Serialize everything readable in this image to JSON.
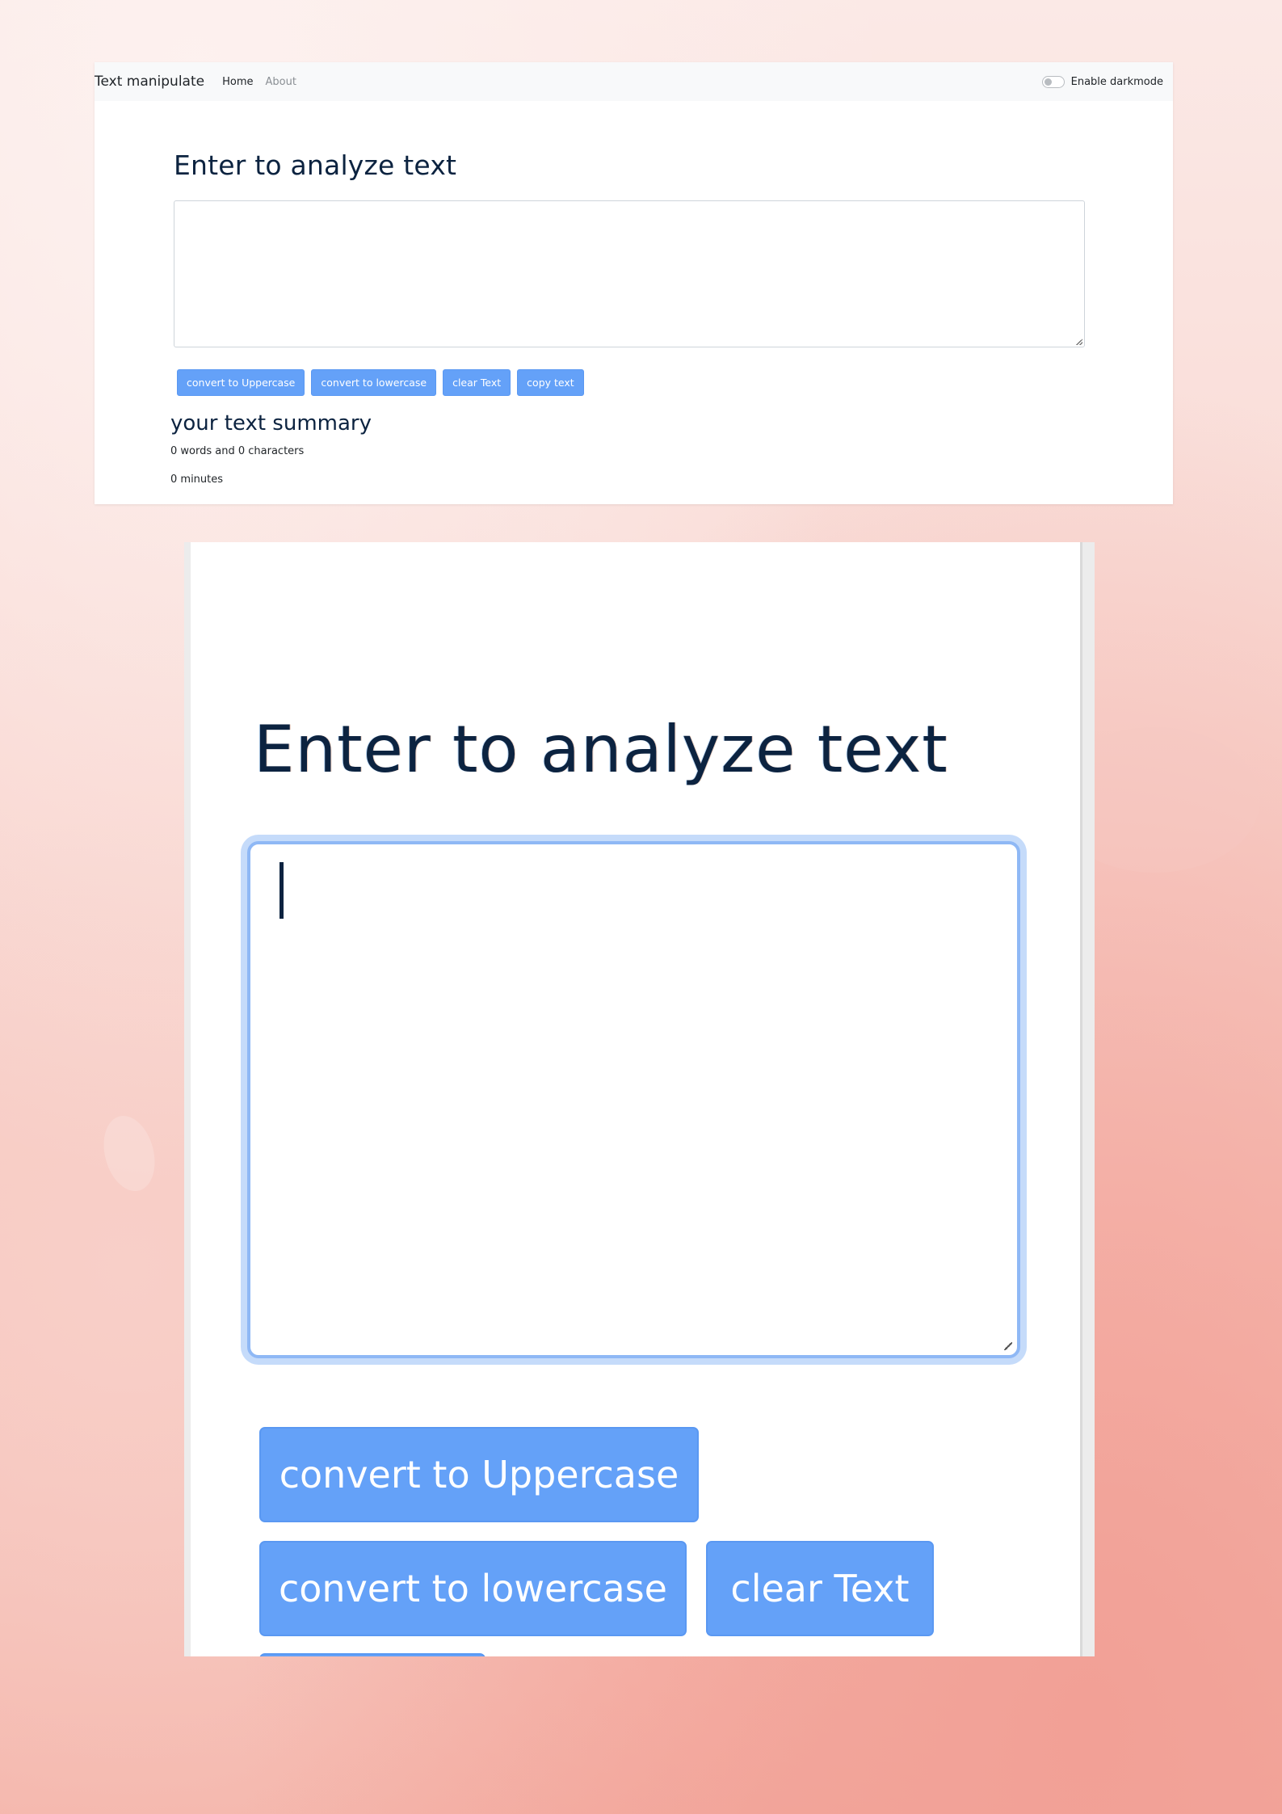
{
  "navbar": {
    "brand": "Text manipulate",
    "links": [
      {
        "label": "Home",
        "active": true
      },
      {
        "label": "About",
        "active": false
      }
    ],
    "darkmode_label": "Enable darkmode",
    "darkmode_enabled": false
  },
  "main": {
    "heading": "Enter to analyze text",
    "textarea_value": "",
    "buttons": {
      "uppercase": "convert to Uppercase",
      "lowercase": "convert to lowercase",
      "clear": "clear Text",
      "copy": "copy text"
    },
    "summary": {
      "heading": "your text summary",
      "words_chars": "0 words and 0 characters",
      "minutes": "0 minutes"
    }
  },
  "zoom": {
    "heading": "Enter to analyze text",
    "buttons": {
      "uppercase": "convert to Uppercase",
      "lowercase": "convert to lowercase",
      "clear": "clear Text"
    }
  },
  "colors": {
    "primary_button": "#64a1f8",
    "heading_text": "#0c2340",
    "navbar_bg": "#f8f9fa",
    "focus_ring": "#c5dbfa"
  }
}
